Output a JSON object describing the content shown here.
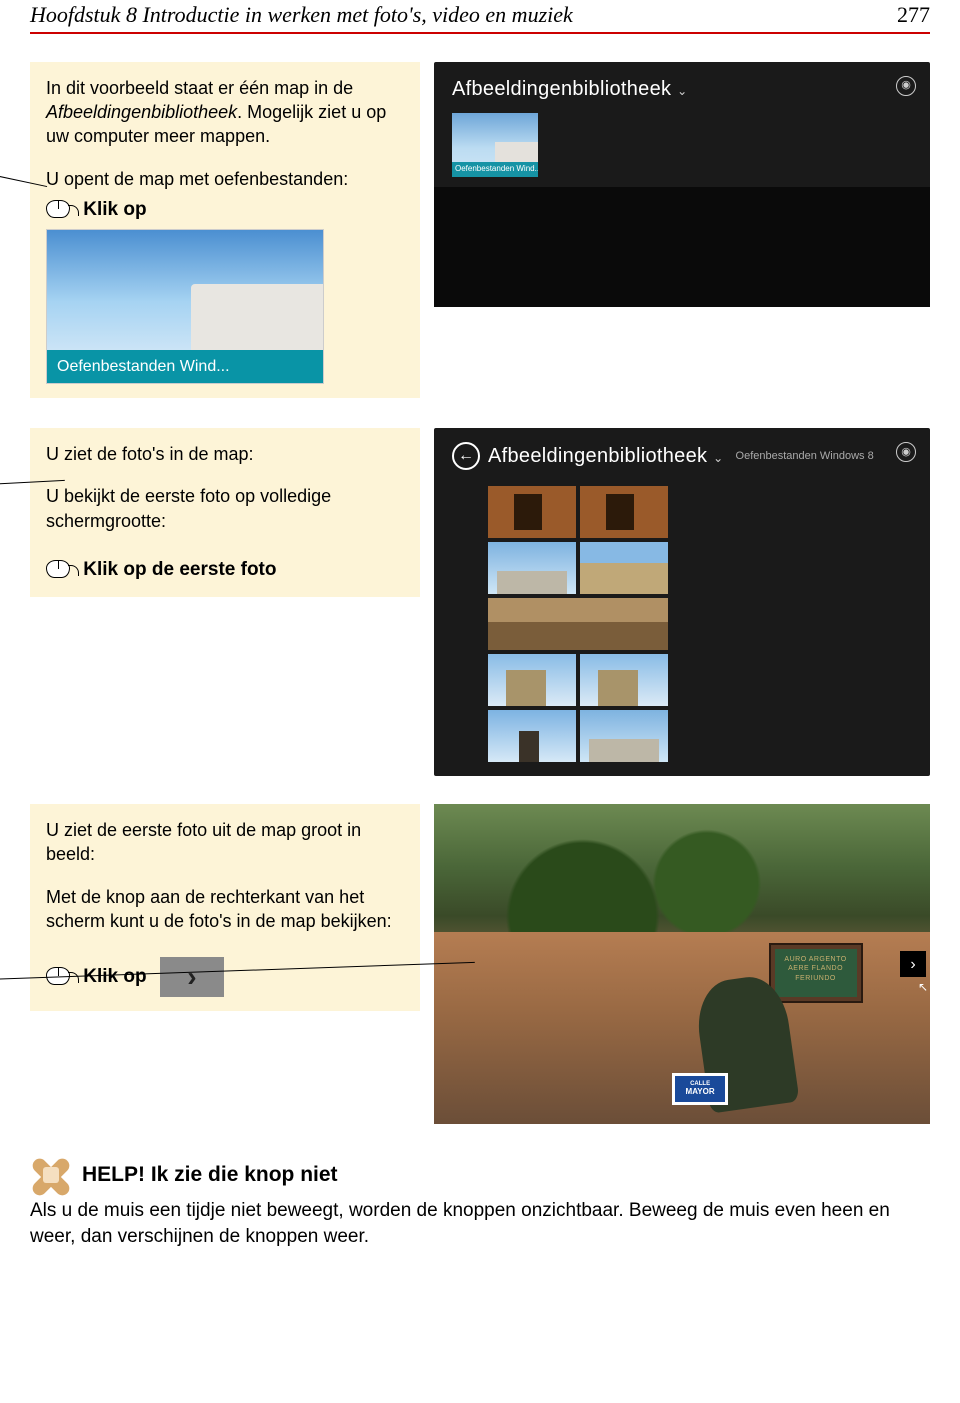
{
  "header": {
    "title": "Hoofdstuk 8 Introductie in werken met foto's, video en muziek",
    "page_number": "277"
  },
  "block1": {
    "p1_a": "In dit voorbeeld staat er één map in de ",
    "p1_term": "Afbeeldingenbibliotheek",
    "p1_b": ". Mogelijk ziet u op uw computer meer mappen.",
    "p2": "U opent de map met oefenbestanden:",
    "action": "Klik op",
    "folder_caption": "Oefenbestanden Wind..."
  },
  "screenshot1": {
    "app_title": "Afbeeldingenbibliotheek",
    "tile_caption": "Oefenbestanden Wind..."
  },
  "block2": {
    "p1": "U ziet de foto's in de map:",
    "p2": "U bekijkt de eerste foto op volledige schermgrootte:",
    "action": "Klik op de eerste foto"
  },
  "screenshot2": {
    "app_title": "Afbeeldingenbibliotheek",
    "subtitle": "Oefenbestanden Windows 8"
  },
  "block3": {
    "p1": "U ziet de eerste foto uit de map groot in beeld:",
    "p2": "Met de knop aan de rechterkant van het scherm kunt u de foto's in de map bekijken:",
    "action": "Klik op"
  },
  "screenshot3": {
    "sign_small": "CALLE",
    "sign_big": "MAYOR",
    "plaque": "AURO\nARGENTO\nAERE\nFLANDO\nFERIUNDO"
  },
  "help": {
    "title": "HELP! Ik zie die knop niet",
    "body": "Als u de muis een tijdje niet beweegt, worden de knoppen onzichtbaar. Beweeg de muis even heen en weer, dan verschijnen de knoppen weer."
  }
}
